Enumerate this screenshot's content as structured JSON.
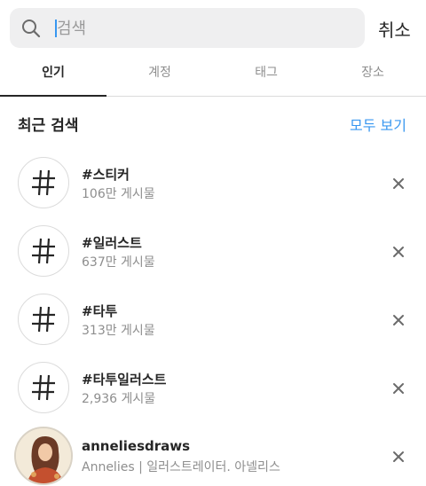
{
  "search": {
    "placeholder": "검색",
    "cancel_label": "취소"
  },
  "tabs": [
    {
      "label": "인기",
      "active": true
    },
    {
      "label": "계정",
      "active": false
    },
    {
      "label": "태그",
      "active": false
    },
    {
      "label": "장소",
      "active": false
    }
  ],
  "recent": {
    "title": "최근 검색",
    "see_all_label": "모두 보기",
    "items": [
      {
        "icon": "hashtag-icon",
        "title": "#스티커",
        "subtitle": "106만 게시물"
      },
      {
        "icon": "hashtag-icon",
        "title": "#일러스트",
        "subtitle": "637만 게시물"
      },
      {
        "icon": "hashtag-icon",
        "title": "#타투",
        "subtitle": "313만 게시물"
      },
      {
        "icon": "hashtag-icon",
        "title": "#타투일러스트",
        "subtitle": "2,936 게시물"
      },
      {
        "icon": "profile-avatar",
        "title": "anneliesdraws",
        "subtitle": "Annelies | 일러스트레이터. 아넬리스"
      }
    ]
  },
  "colors": {
    "accent": "#3897f0",
    "text": "#262626",
    "secondary": "#8e8e8e",
    "search_bg": "#efeff0",
    "divider": "#dbdbdb"
  }
}
